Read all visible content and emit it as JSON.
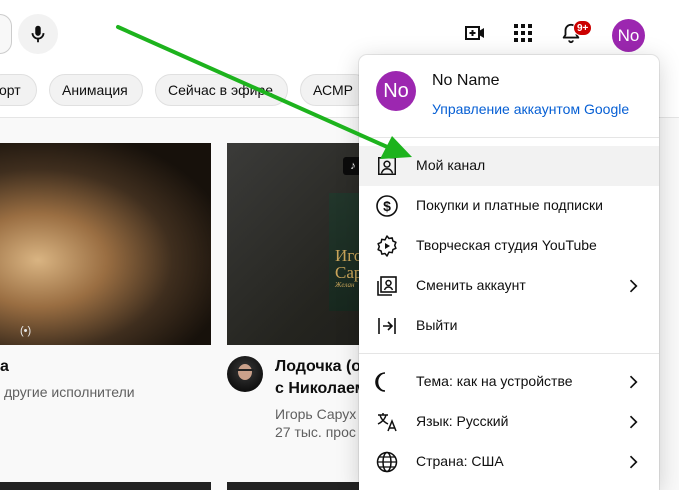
{
  "chips": [
    {
      "label": "орт"
    },
    {
      "label": "Анимация"
    },
    {
      "label": "Сейчас в эфире"
    },
    {
      "label": "АСМР"
    }
  ],
  "header": {
    "notification_count": "9+",
    "avatar_initials": "No"
  },
  "videos": {
    "left": {
      "title": "а",
      "meta": "другие исполнители"
    },
    "right": {
      "title_line1": "Лодочка (о",
      "title_line2": "с Николаем",
      "channel": "Игорь Сарух",
      "stats": "27 тыс. прос",
      "poster_line1": "Игор",
      "poster_line2": "Сар",
      "poster_line3": "Желан"
    }
  },
  "account_menu": {
    "avatar_initials": "No",
    "name": "No Name",
    "manage_label": "Управление аккаунтом Google",
    "items": [
      {
        "label": "Мой канал",
        "icon": "person-icon"
      },
      {
        "label": "Покупки и платные подписки",
        "icon": "dollar-icon"
      },
      {
        "label": "Творческая студия YouTube",
        "icon": "gear-icon"
      },
      {
        "label": "Сменить аккаунт",
        "icon": "switch-account-icon"
      },
      {
        "label": "Выйти",
        "icon": "sign-out-icon"
      },
      {
        "label": "Тема: как на устройстве",
        "icon": "moon-icon"
      },
      {
        "label": "Язык: Русский",
        "icon": "translate-icon"
      },
      {
        "label": "Страна: США",
        "icon": "globe-icon"
      }
    ]
  },
  "colors": {
    "avatar": "#9c27b0",
    "link": "#065fd4",
    "badge": "#cc0000",
    "arrow": "#1db31d"
  }
}
